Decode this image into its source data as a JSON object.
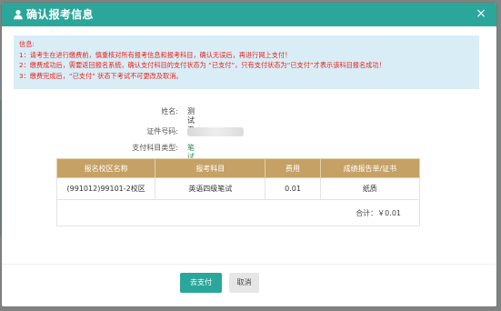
{
  "dialog": {
    "title": "确认报考信息",
    "close_glyph": "×"
  },
  "notice": {
    "heading": "信息:",
    "lines": [
      "1：请考生在进行缴费前，慎重核对所有报考信息和报考科目，确认无误后，再进行网上支付！",
      "2：缴费成功后，需要返回报名系统，确认支付科目的支付状态为 “已支付”，只有支付状态为“已支付”才表示该科目报名成功！",
      "3：缴费完成后，“已支付” 状态下考试不可更改及取消。"
    ]
  },
  "candidate": {
    "name_label": "姓名:",
    "name_value": "测试五",
    "id_label": "证件号码:",
    "id_value": "5",
    "pay_subject_type_label": "支付科目类型:",
    "pay_subject_type_value": "笔试"
  },
  "table": {
    "headers": [
      "报名校区名称",
      "报考科目",
      "费用",
      "成绩报告单/证书"
    ],
    "rows": [
      [
        "(991012)99101-2校区",
        "英语四级笔试",
        "0.01",
        "纸质"
      ]
    ],
    "total_text": "合计：￥0.01"
  },
  "buttons": {
    "pay_label": "去支付",
    "cancel_label": "取消"
  },
  "colors": {
    "header_bg": "#2aa79a",
    "notice_bg": "#d9edf7",
    "notice_text": "#e5251d",
    "table_header_bg": "#c6a166",
    "primary_button": "#2aa79a",
    "subject_type_value": "#2e8b57"
  },
  "icons": {
    "title_icon": "user-icon",
    "close_icon": "close-icon"
  }
}
